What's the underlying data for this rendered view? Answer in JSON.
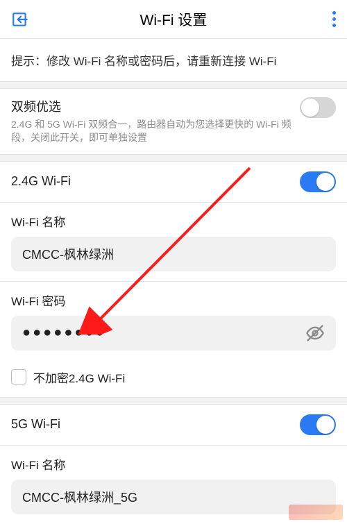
{
  "header": {
    "title": "Wi-Fi 设置"
  },
  "tip": "提示：修改 Wi-Fi 名称或密码后，请重新连接 Wi-Fi",
  "dualBand": {
    "title": "双频优选",
    "subtitle": "2.4G 和 5G Wi-Fi 双频合一，路由器自动为您选择更快的 Wi-Fi 频段，关闭此开关，即可单独设置",
    "on": false
  },
  "band24": {
    "toggleLabel": "2.4G Wi-Fi",
    "on": true,
    "nameLabel": "Wi-Fi 名称",
    "nameValue": "CMCC-枫林绿洲",
    "pwLabel": "Wi-Fi 密码",
    "pwMask": "●●●●●●●●",
    "noEncryptLabel": "不加密2.4G Wi-Fi"
  },
  "band5": {
    "toggleLabel": "5G Wi-Fi",
    "on": true,
    "nameLabel": "Wi-Fi 名称",
    "nameValue": "CMCC-枫林绿洲_5G"
  }
}
